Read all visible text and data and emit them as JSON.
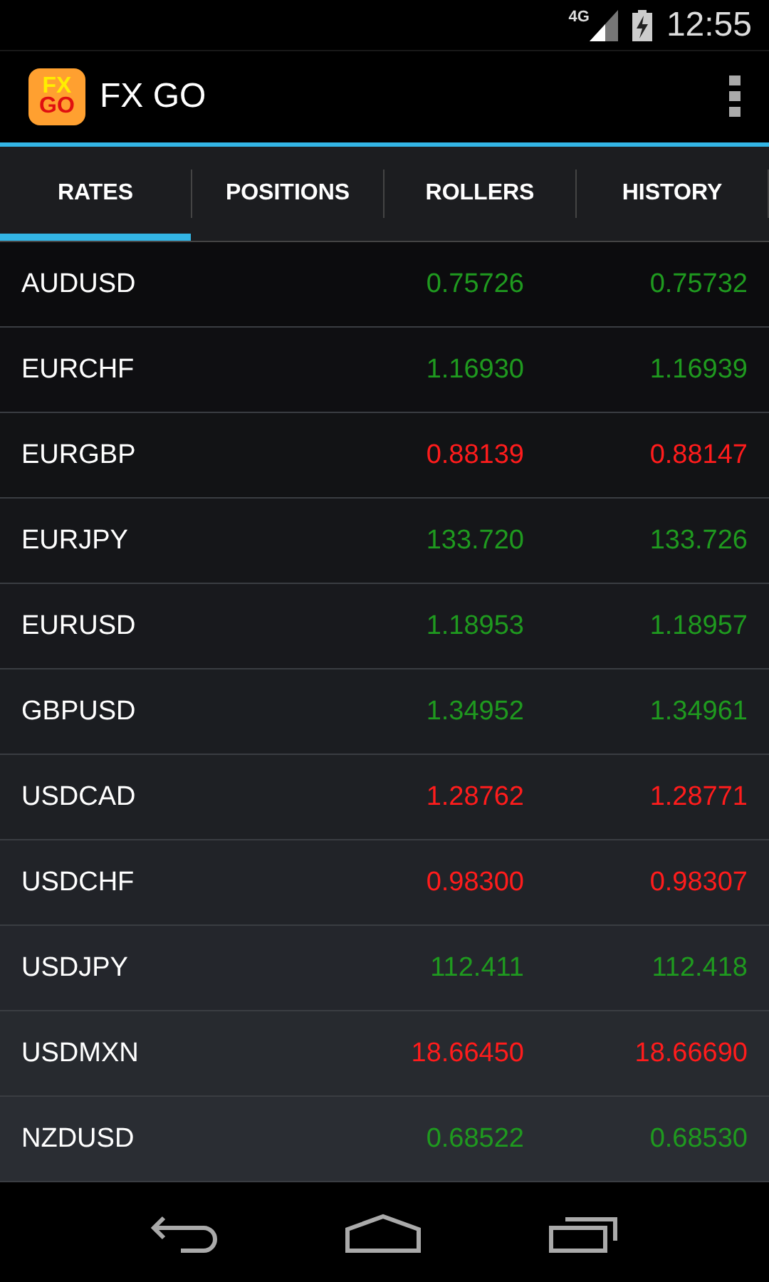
{
  "status_bar": {
    "network": "4G",
    "time": "12:55"
  },
  "action_bar": {
    "logo_top": "FX",
    "logo_bottom": "GO",
    "title": "FX GO"
  },
  "tabs": [
    {
      "label": "RATES",
      "selected": true
    },
    {
      "label": "POSITIONS",
      "selected": false
    },
    {
      "label": "ROLLERS",
      "selected": false
    },
    {
      "label": "HISTORY",
      "selected": false
    }
  ],
  "rates": [
    {
      "pair": "AUDUSD",
      "bid": "0.75726",
      "ask": "0.75732",
      "color": "#1f9a1f"
    },
    {
      "pair": "EURCHF",
      "bid": "1.16930",
      "ask": "1.16939",
      "color": "#1f9a1f"
    },
    {
      "pair": "EURGBP",
      "bid": "0.88139",
      "ask": "0.88147",
      "color": "#ff1c1c"
    },
    {
      "pair": "EURJPY",
      "bid": "133.720",
      "ask": "133.726",
      "color": "#1f9a1f"
    },
    {
      "pair": "EURUSD",
      "bid": "1.18953",
      "ask": "1.18957",
      "color": "#1f9a1f"
    },
    {
      "pair": "GBPUSD",
      "bid": "1.34952",
      "ask": "1.34961",
      "color": "#1f9a1f"
    },
    {
      "pair": "USDCAD",
      "bid": "1.28762",
      "ask": "1.28771",
      "color": "#ff1c1c"
    },
    {
      "pair": "USDCHF",
      "bid": "0.98300",
      "ask": "0.98307",
      "color": "#ff1c1c"
    },
    {
      "pair": "USDJPY",
      "bid": "112.411",
      "ask": "112.418",
      "color": "#1f9a1f"
    },
    {
      "pair": "USDMXN",
      "bid": "18.66450",
      "ask": "18.66690",
      "color": "#ff1c1c"
    },
    {
      "pair": "NZDUSD",
      "bid": "0.68522",
      "ask": "0.68530",
      "color": "#1f9a1f"
    }
  ]
}
